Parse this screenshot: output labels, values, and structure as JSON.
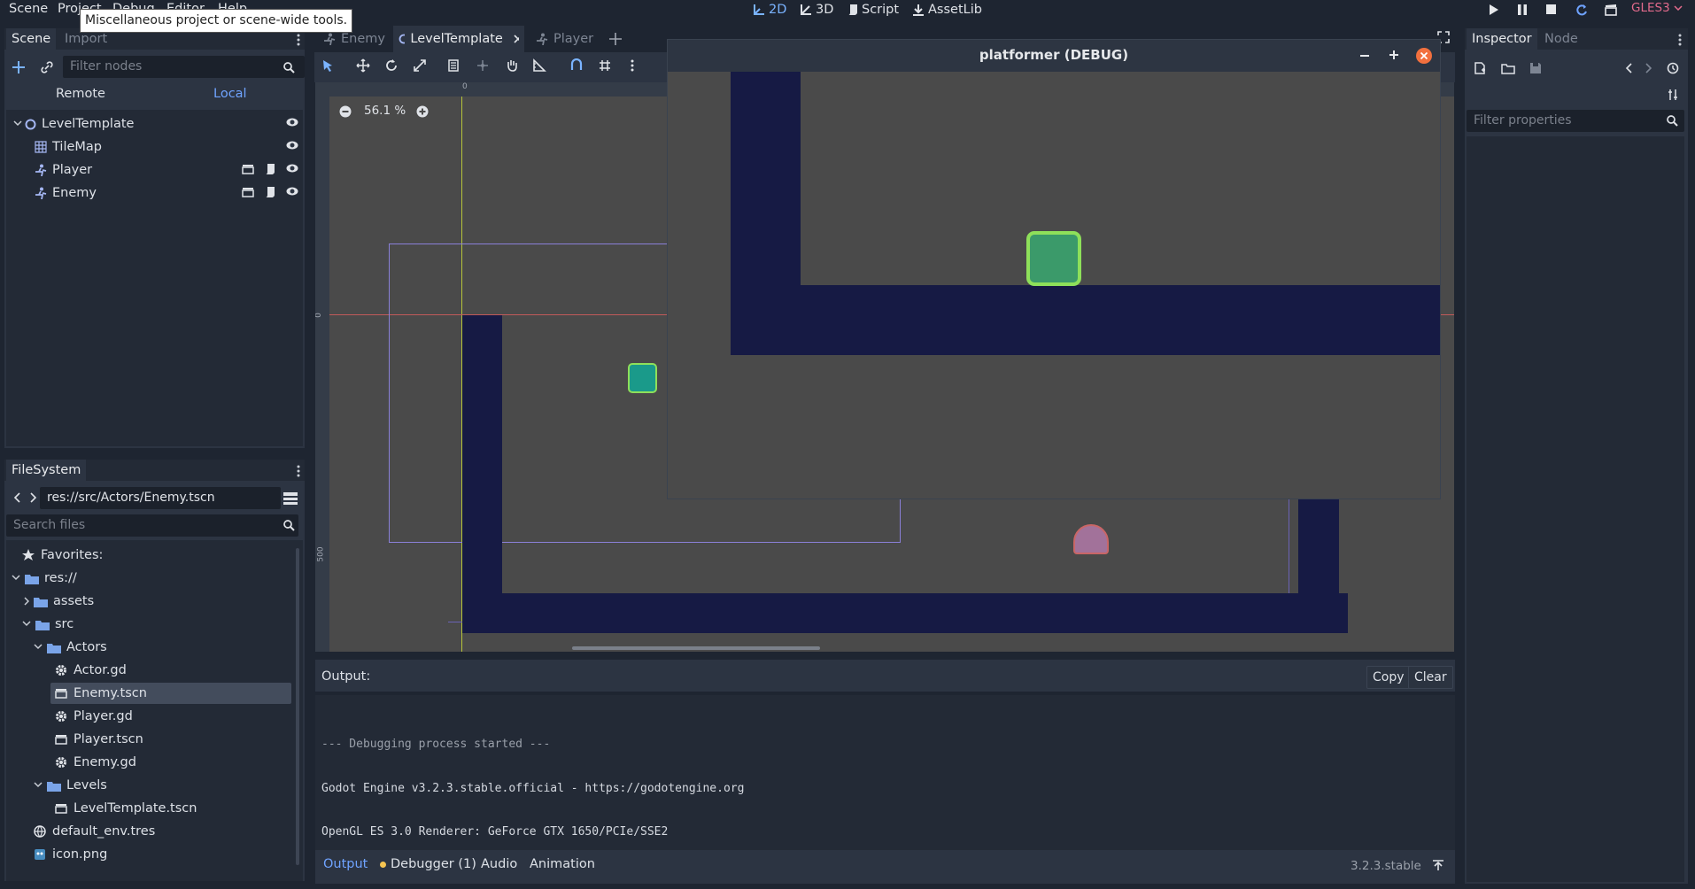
{
  "menu": {
    "scene": "Scene",
    "project": "Project",
    "debug": "Debug",
    "editor": "Editor",
    "help": "Help"
  },
  "tooltip": "Miscellaneous project or scene-wide tools.",
  "workspaces": {
    "two_d": "2D",
    "three_d": "3D",
    "script": "Script",
    "assetlib": "AssetLib"
  },
  "renderer": "GLES3",
  "scene_dock": {
    "tab_scene": "Scene",
    "tab_import": "Import",
    "filter_placeholder": "Filter nodes",
    "remote": "Remote",
    "local": "Local",
    "nodes": [
      {
        "label": "LevelTemplate"
      },
      {
        "label": "TileMap"
      },
      {
        "label": "Player"
      },
      {
        "label": "Enemy"
      }
    ]
  },
  "filesystem": {
    "title": "FileSystem",
    "path": "res://src/Actors/Enemy.tscn",
    "search_placeholder": "Search files",
    "items": [
      {
        "label": "Favorites:"
      },
      {
        "label": "res://"
      },
      {
        "label": "assets"
      },
      {
        "label": "src"
      },
      {
        "label": "Actors"
      },
      {
        "label": "Actor.gd"
      },
      {
        "label": "Enemy.tscn"
      },
      {
        "label": "Player.gd"
      },
      {
        "label": "Player.tscn"
      },
      {
        "label": "Enemy.gd"
      },
      {
        "label": "Levels"
      },
      {
        "label": "LevelTemplate.tscn"
      },
      {
        "label": "default_env.tres"
      },
      {
        "label": "icon.png"
      }
    ]
  },
  "editor_tabs": [
    {
      "label": "Enemy"
    },
    {
      "label": "LevelTemplate"
    },
    {
      "label": "Player"
    }
  ],
  "viewport": {
    "zoom": "56.1 %",
    "ruler_zero": "0",
    "ruler_500": "500"
  },
  "game_window": {
    "title": "platformer (DEBUG)"
  },
  "output": {
    "title": "Output:",
    "copy": "Copy",
    "clear": "Clear",
    "lines": [
      "--- Debugging process started ---",
      "Godot Engine v3.2.3.stable.official - https://godotengine.org",
      "OpenGL ES 3.0 Renderer: GeForce GTX 1650/PCIe/SSE2"
    ]
  },
  "bottom_tabs": {
    "output": "Output",
    "debugger": "Debugger (1)",
    "audio": "Audio",
    "animation": "Animation"
  },
  "version": "3.2.3.stable",
  "inspector": {
    "tab_inspector": "Inspector",
    "tab_node": "Node",
    "filter_placeholder": "Filter properties"
  },
  "colors": {
    "accent": "#6fa3ff",
    "tilemap_navy": "#161a44",
    "player_green": "#3b9a6a",
    "player_outline": "#8ee05a",
    "debugger_dot": "#f5c451"
  }
}
